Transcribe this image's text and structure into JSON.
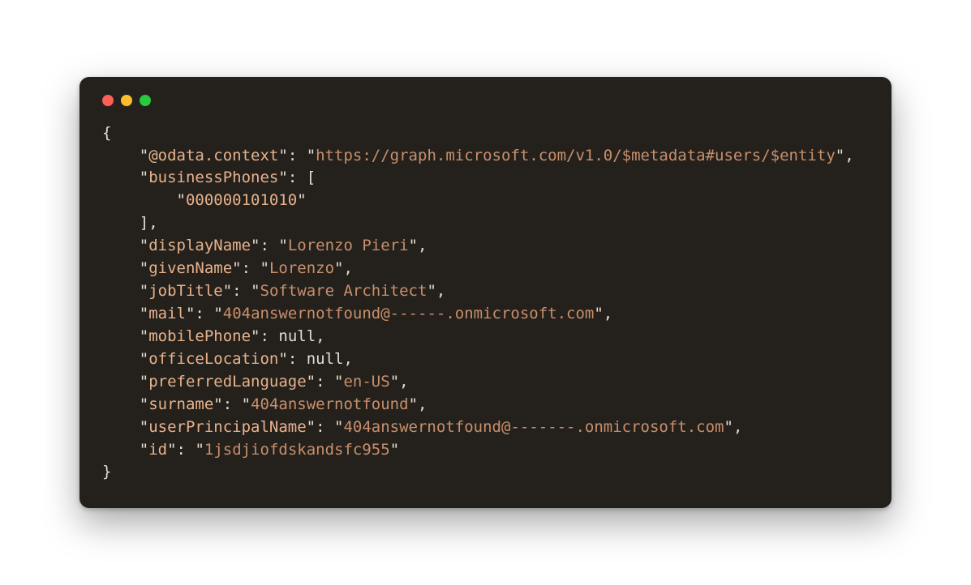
{
  "keys": {
    "odata": "@odata.context",
    "businessPhones": "businessPhones",
    "displayName": "displayName",
    "givenName": "givenName",
    "jobTitle": "jobTitle",
    "mail": "mail",
    "mobilePhone": "mobilePhone",
    "officeLocation": "officeLocation",
    "preferredLanguage": "preferredLanguage",
    "surname": "surname",
    "userPrincipalName": "userPrincipalName",
    "id": "id"
  },
  "values": {
    "odata": "https://graph.microsoft.com/v1.0/$metadata#users/$entity",
    "businessPhone0": "000000101010",
    "displayName": "Lorenzo Pieri",
    "givenName": "Lorenzo",
    "jobTitle": "Software Architect",
    "mail": "404answernotfound@------.onmicrosoft.com",
    "mobilePhone": "null",
    "officeLocation": "null",
    "preferredLanguage": "en-US",
    "surname": "404answernotfound",
    "userPrincipalName": "404answernotfound@-------.onmicrosoft.com",
    "id": "1jsdjiofdskandsfc955"
  },
  "punct": {
    "openBrace": "{",
    "closeBrace": "}",
    "openBracket": "[",
    "closeBracket": "]",
    "colon": ":",
    "comma": ",",
    "quote": "\""
  }
}
